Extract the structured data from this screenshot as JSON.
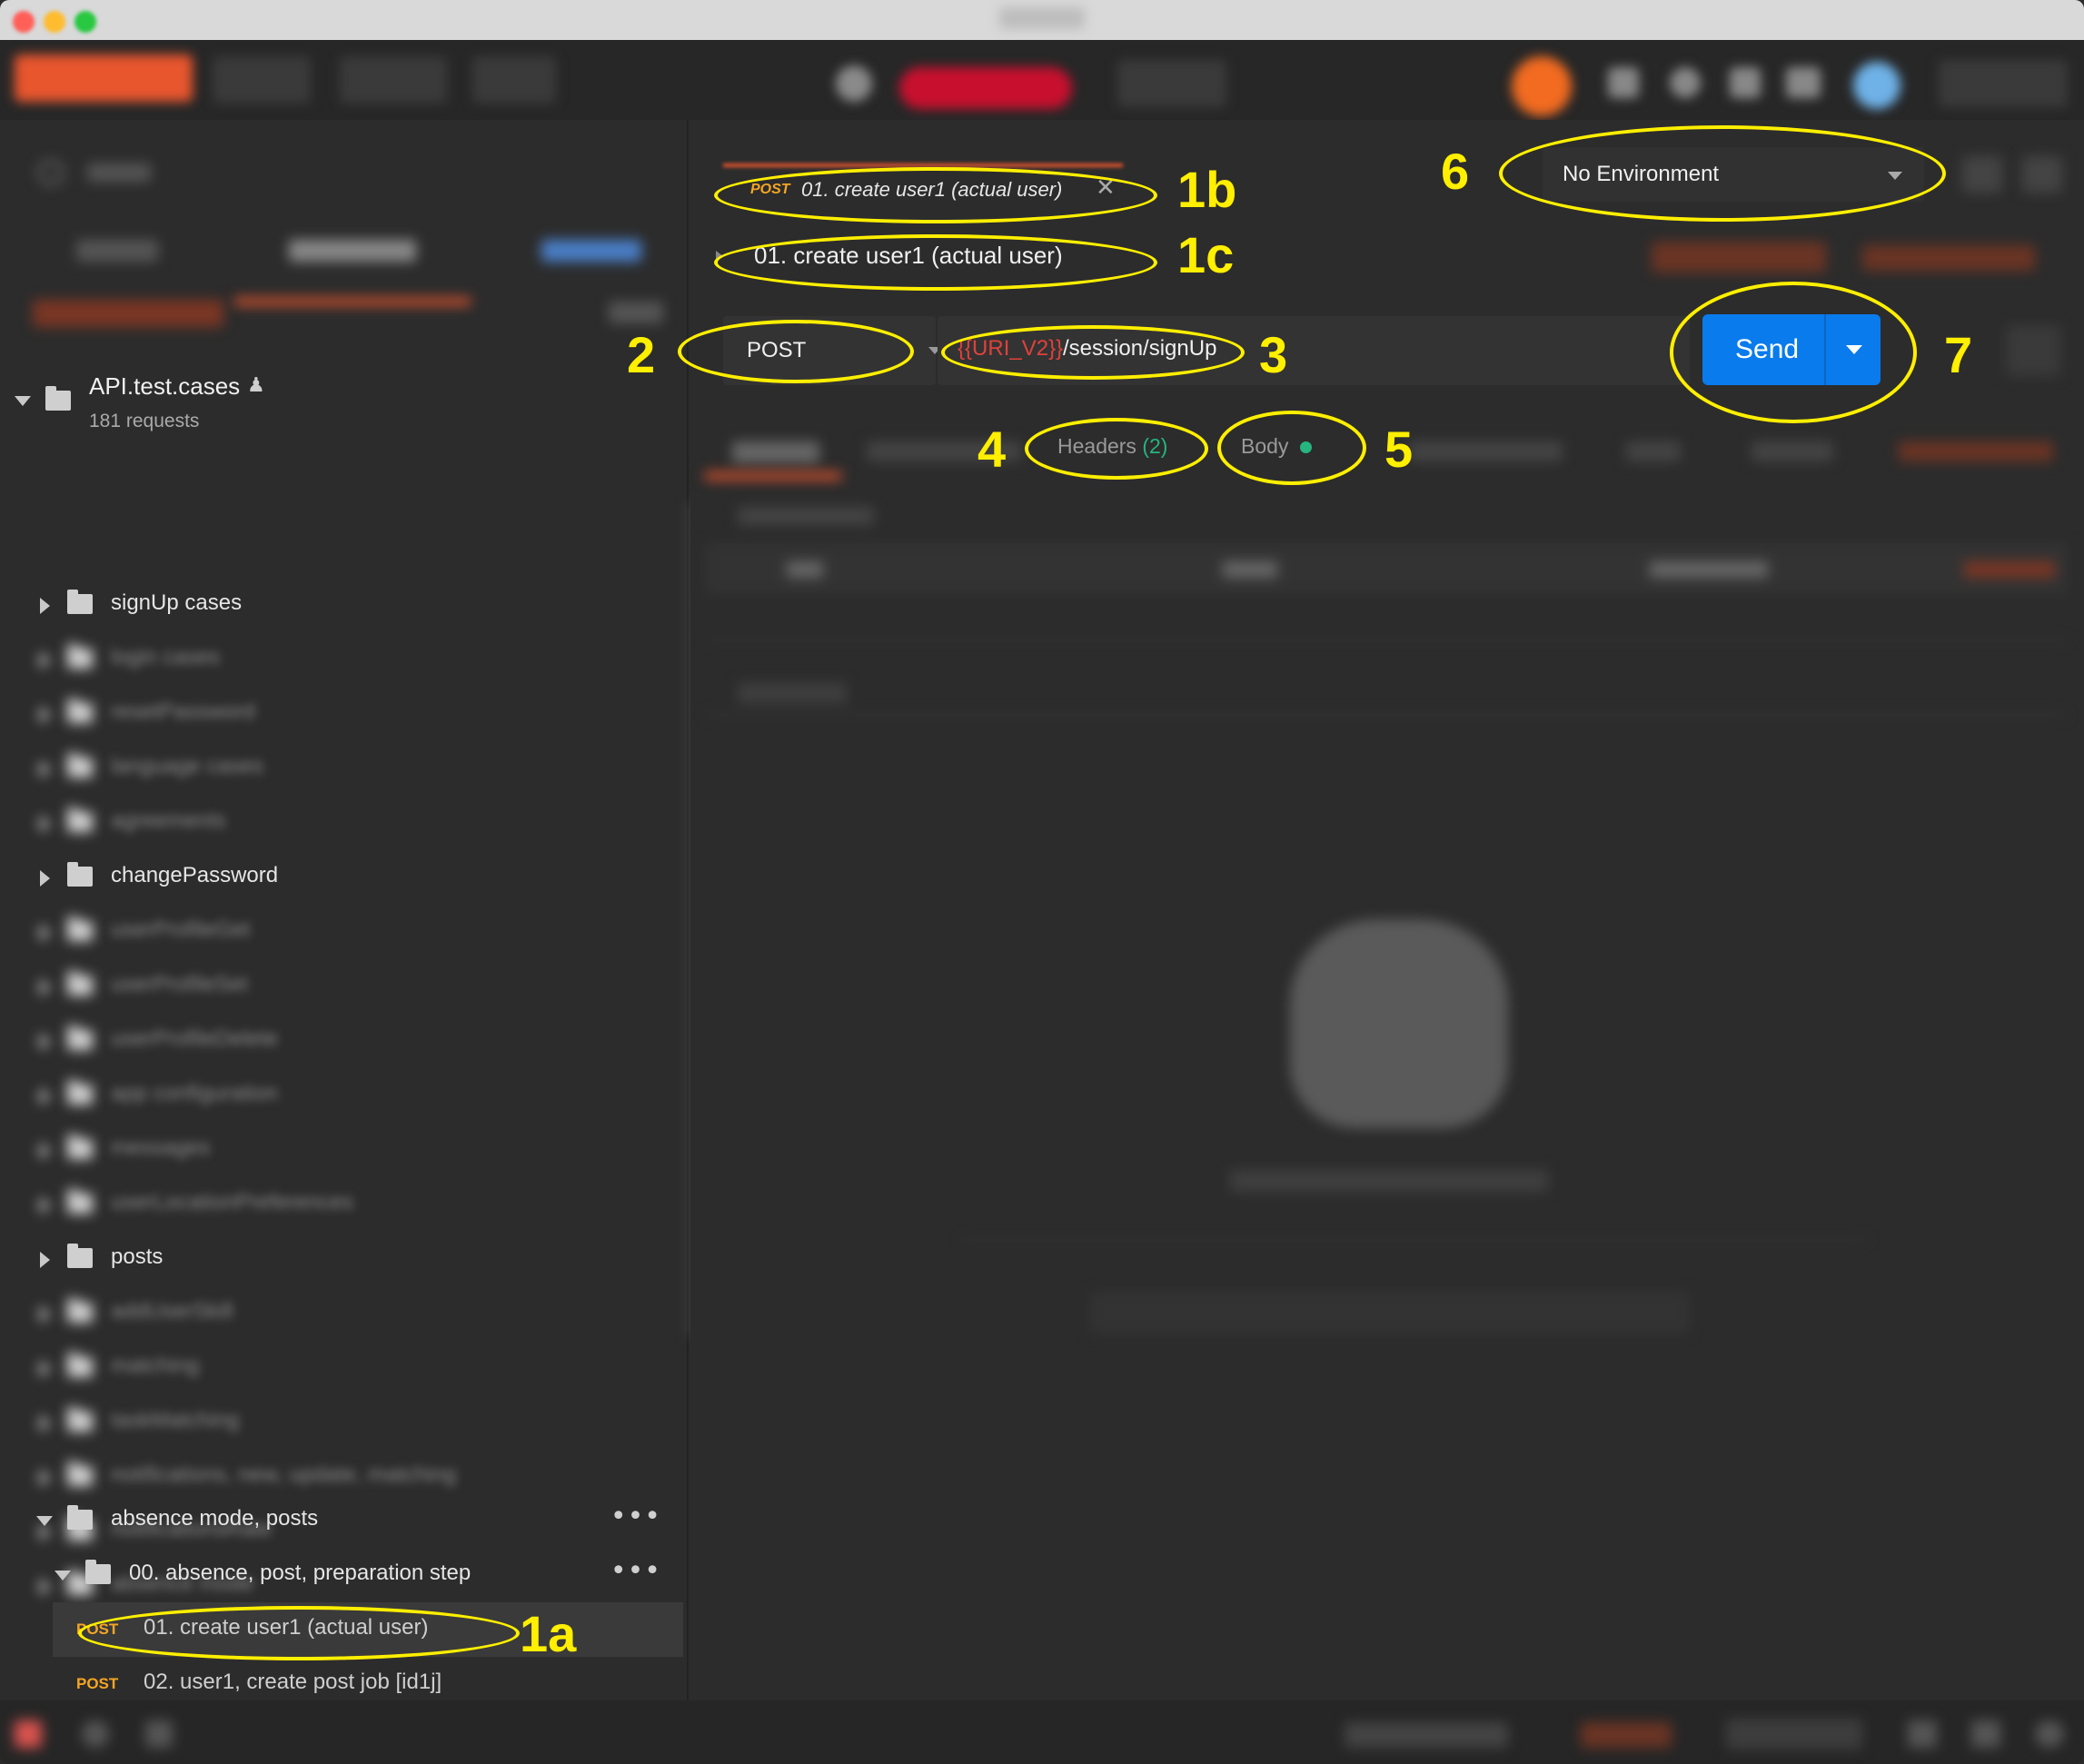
{
  "sidebar": {
    "collection": {
      "name": "API.test.cases",
      "count": "181 requests"
    },
    "folders": [
      {
        "label": "signUp cases",
        "state": "collapsed",
        "clear": true
      },
      {
        "label": "login cases",
        "clear": false
      },
      {
        "label": "resetPassword",
        "clear": false
      },
      {
        "label": "language cases",
        "clear": false
      },
      {
        "label": "agreements",
        "clear": false
      },
      {
        "label": "changePassword",
        "state": "collapsed",
        "clear": true
      },
      {
        "label": "userProfileGet",
        "clear": false
      },
      {
        "label": "userProfileSet",
        "clear": false
      },
      {
        "label": "userProfileDelete",
        "clear": false
      },
      {
        "label": "app configuration",
        "clear": false
      },
      {
        "label": "messages",
        "clear": false
      },
      {
        "label": "userLocationPreferences",
        "clear": false
      },
      {
        "label": "posts",
        "state": "collapsed",
        "clear": true
      },
      {
        "label": "addUserSkill",
        "clear": false
      },
      {
        "label": "matching",
        "clear": false
      },
      {
        "label": "taskMatching",
        "clear": false
      },
      {
        "label": "notifications, new, update, matching",
        "clear": false
      },
      {
        "label": "notificationsRate",
        "clear": false
      },
      {
        "label": "absence mode",
        "clear": false
      }
    ],
    "open_folder": {
      "label": "absence mode, posts",
      "more": "•••"
    },
    "subfolder": {
      "label": "00. absence, post, preparation step",
      "more": "•••"
    },
    "requests": [
      {
        "method": "POST",
        "label": "01. create user1 (actual user)"
      },
      {
        "method": "POST",
        "label": "02. user1, create post job [id1j]"
      }
    ]
  },
  "request": {
    "tab": {
      "method": "POST",
      "title": "01. create user1 (actual user)",
      "close": "✕"
    },
    "name": "01. create user1 (actual user)",
    "method": "POST",
    "url_var": "{{URI_V2}}",
    "url_path": "/session/signUp",
    "tabs": {
      "headers": "Headers",
      "headers_count": "(2)",
      "body": "Body"
    },
    "send": "Send"
  },
  "environment": {
    "selected": "No Environment"
  },
  "annotations": [
    "1a",
    "1b",
    "1c",
    "2",
    "3",
    "4",
    "5",
    "6",
    "7"
  ],
  "colors": {
    "accent": "#e8562e",
    "send": "#097bed",
    "annotation": "#ffef00",
    "post": "#f5a623",
    "count": "#26b47f"
  }
}
